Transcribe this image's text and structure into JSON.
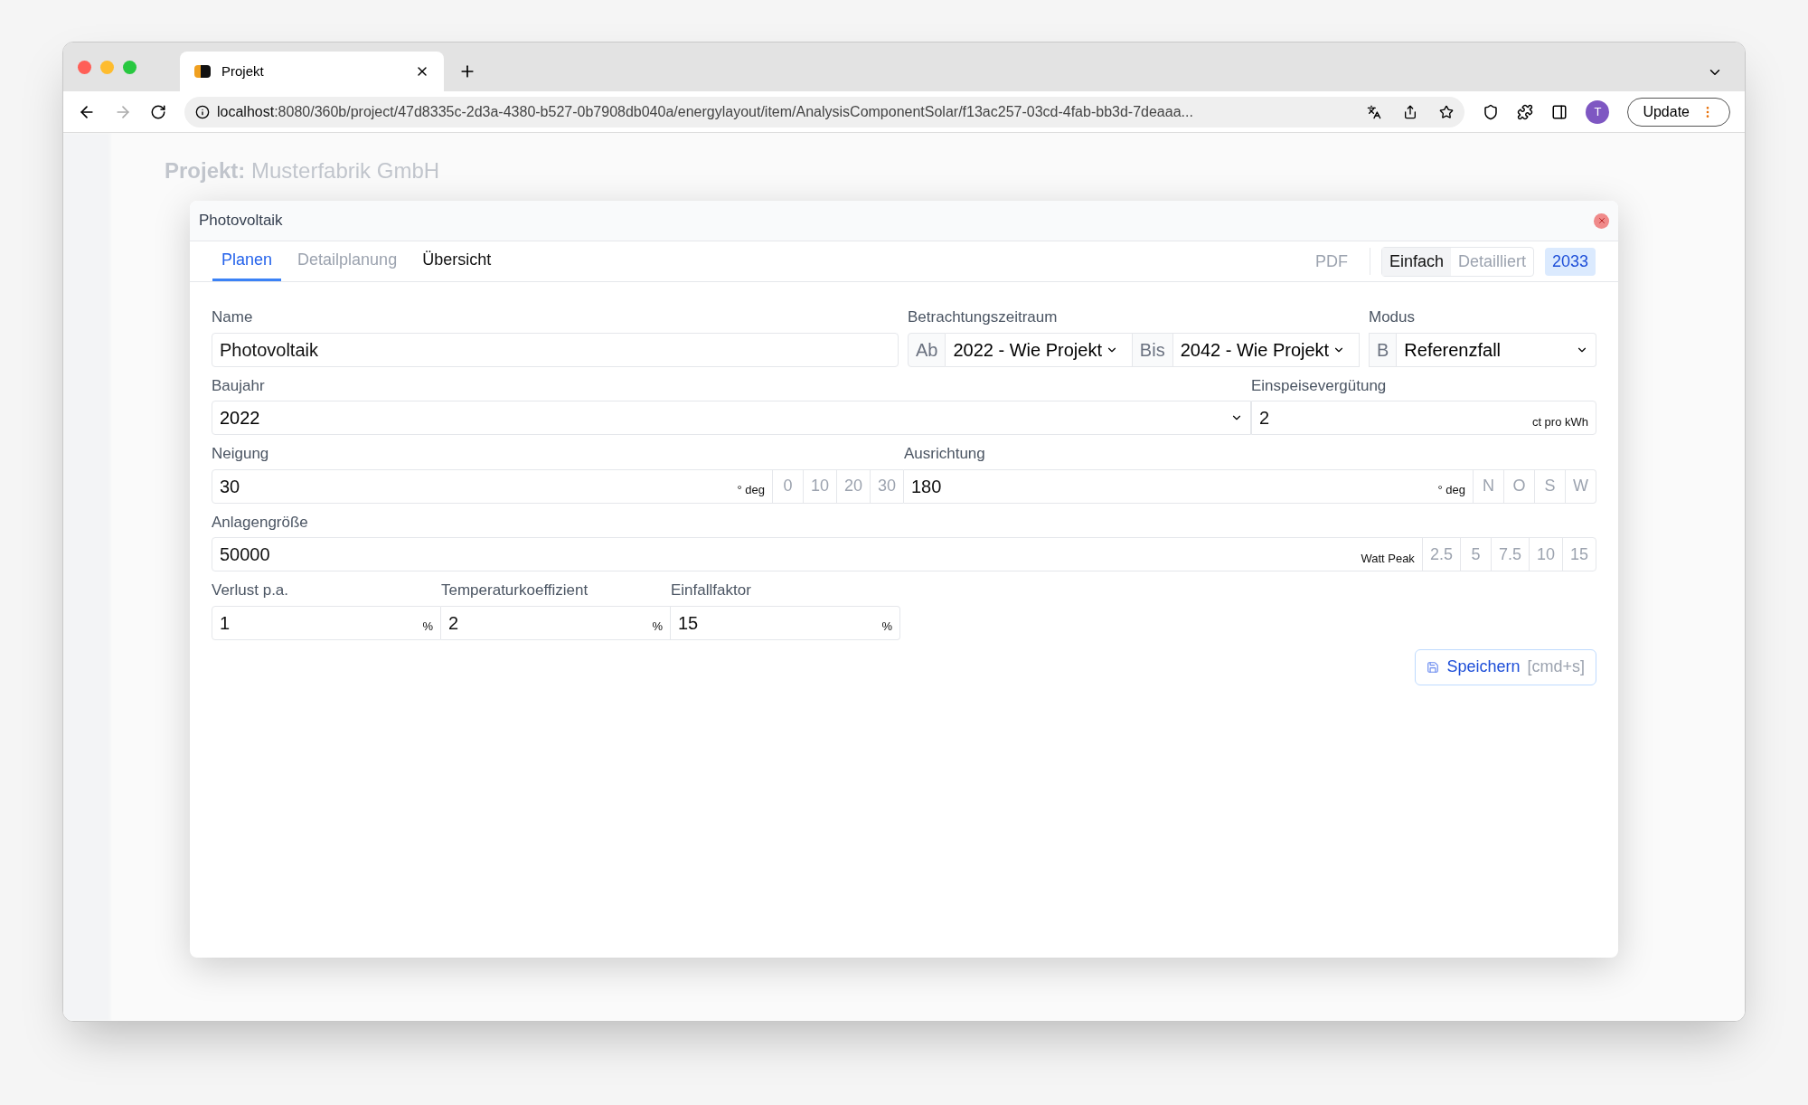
{
  "browser": {
    "tabs": [
      {
        "title": "Projekt",
        "selected": true
      }
    ],
    "url_host": "localhost",
    "url_rest": ":8080/360b/project/47d8335c-2d3a-4380-b527-0b7908db040a/energylayout/item/AnalysisComponentSolar/f13ac257-03cd-4fab-bb3d-7deaaa...",
    "avatar": "T",
    "update_button": "Update"
  },
  "background": {
    "heading": "**Projekt:** Musterfabrik GmbH"
  },
  "modal": {
    "title": "Photovoltaik",
    "tabs": [
      {
        "label": "Planen",
        "selected": true,
        "disabled": false
      },
      {
        "label": "Detailplanung",
        "selected": false,
        "disabled": true
      },
      {
        "label": "Übersicht",
        "selected": false,
        "disabled": false
      }
    ],
    "pdf": "PDF",
    "view_modes": [
      {
        "label": "Einfach",
        "selected": true
      },
      {
        "label": "Detailliert",
        "selected": false
      }
    ],
    "year": "2033",
    "name": {
      "label": "Name",
      "value": "Photovoltaik"
    },
    "period": {
      "label": "Betrachtungszeitraum",
      "from_prefix": "Ab",
      "from": "2022 - Wie Projekt",
      "to_prefix": "Bis",
      "to": "2042 - Wie Projekt"
    },
    "mode": {
      "label": "Modus",
      "prefix": "B",
      "value": "Referenzfall"
    },
    "build_year": {
      "label": "Baujahr",
      "value": "2022"
    },
    "feed_in": {
      "label": "Einspeisevergütung",
      "value": "2",
      "unit": "ct pro kWh"
    },
    "tilt": {
      "label": "Neigung",
      "value": "30",
      "unit": "° deg",
      "presets": [
        "0",
        "10",
        "20",
        "30"
      ]
    },
    "orientation": {
      "label": "Ausrichtung",
      "value": "180",
      "unit": "° deg",
      "presets": [
        "N",
        "O",
        "S",
        "W"
      ]
    },
    "size": {
      "label": "Anlagengröße",
      "value": "50000",
      "unit": "Watt Peak",
      "presets": [
        "2.5",
        "5",
        "7.5",
        "10",
        "15"
      ]
    },
    "small_fields": [
      {
        "label": "Verlust p.a.",
        "value": "1",
        "unit": "%"
      },
      {
        "label": "Temperaturkoeffizient",
        "value": "2",
        "unit": "%"
      },
      {
        "label": "Einfallfaktor",
        "value": "15",
        "unit": "%"
      }
    ],
    "save": {
      "label": "Speichern",
      "shortcut": "[cmd+s]"
    }
  }
}
